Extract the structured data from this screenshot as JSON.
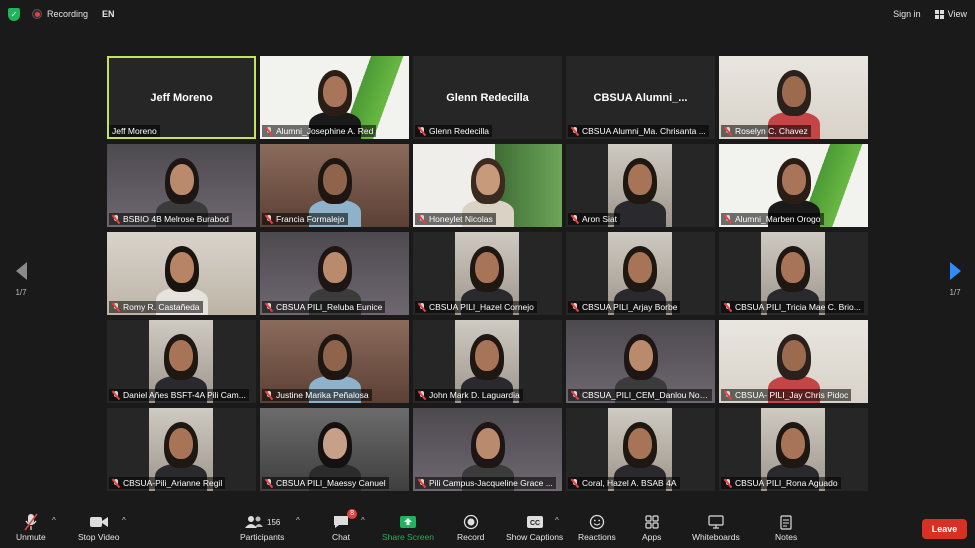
{
  "topbar": {
    "recording_label": "Recording",
    "language": "EN",
    "sign_in": "Sign in",
    "view": "View"
  },
  "pagination": {
    "left": "1/7",
    "right": "1/7"
  },
  "participants": [
    {
      "name": "Jeff Moreno",
      "center_name": "Jeff Moreno",
      "muted": false,
      "active": true,
      "video": false
    },
    {
      "name": "Alumni_Josephine A. Red",
      "muted": true,
      "video": true,
      "scene": "banner"
    },
    {
      "name": "Glenn Redecilla",
      "center_name": "Glenn Redecilla",
      "muted": true,
      "video": false
    },
    {
      "name": "CBSUA Alumni_Ma. Chrisanta ...",
      "center_name": "CBSUA  Alumni_...",
      "muted": true,
      "video": false
    },
    {
      "name": "Roselyn C. Chavez",
      "muted": true,
      "video": true,
      "scene": "light"
    },
    {
      "name": "BSBIO 4B Melrose Burabod",
      "muted": true,
      "video": true,
      "scene": "room"
    },
    {
      "name": "Francia Formalejo",
      "muted": true,
      "video": true,
      "scene": "warm"
    },
    {
      "name": "Honeylet Nicolas",
      "muted": true,
      "video": true,
      "scene": "plant"
    },
    {
      "name": "Aron Siat",
      "muted": true,
      "video": true,
      "scene": "portrait"
    },
    {
      "name": "Alumni_Marben Orogo",
      "muted": true,
      "video": true,
      "scene": "banner"
    },
    {
      "name": "Romy R. Castañeda",
      "muted": true,
      "video": true,
      "scene": "books"
    },
    {
      "name": "CBSUA PILI_Reluba Eunice",
      "muted": true,
      "video": true,
      "scene": "room"
    },
    {
      "name": "CBSUA PILI_Hazel Cornejo",
      "muted": true,
      "video": true,
      "scene": "portrait"
    },
    {
      "name": "CBSUA PILI_Arjay Borbe",
      "muted": true,
      "video": true,
      "scene": "portrait"
    },
    {
      "name": "CBSUA PILI_Tricia Mae C. Brio...",
      "muted": true,
      "video": true,
      "scene": "portrait"
    },
    {
      "name": "Daniel Añes BSFT-4A Pili Cam...",
      "muted": true,
      "video": true,
      "scene": "portrait"
    },
    {
      "name": "Justine Marika Peñalosa",
      "muted": true,
      "video": true,
      "scene": "warm"
    },
    {
      "name": "John Mark D. Laguardia",
      "muted": true,
      "video": true,
      "scene": "portrait"
    },
    {
      "name": "CBSUA_PILI_CEM_Danlou Nola...",
      "muted": true,
      "video": true,
      "scene": "room"
    },
    {
      "name": "CBSUA- PILI_Jay Chris Pidoc",
      "muted": true,
      "video": true,
      "scene": "light"
    },
    {
      "name": "CBSUA-Pili_Arianne Regil",
      "muted": true,
      "video": true,
      "scene": "portrait"
    },
    {
      "name": "CBSUA PILI_Maessy Canuel",
      "muted": true,
      "video": true,
      "scene": "close"
    },
    {
      "name": "Pili Campus-Jacqueline Grace ...",
      "muted": true,
      "video": true,
      "scene": "room"
    },
    {
      "name": "Coral, Hazel A. BSAB 4A",
      "muted": true,
      "video": true,
      "scene": "portrait"
    },
    {
      "name": "CBSUA PILI_Rona Aguado",
      "muted": true,
      "video": true,
      "scene": "portrait"
    }
  ],
  "toolbar": {
    "unmute": "Unmute",
    "stop_video": "Stop Video",
    "participants": "Participants",
    "participants_count": "156",
    "chat": "Chat",
    "chat_badge": "8",
    "share_screen": "Share Screen",
    "record": "Record",
    "show_captions": "Show Captions",
    "reactions": "Reactions",
    "apps": "Apps",
    "whiteboards": "Whiteboards",
    "notes": "Notes",
    "leave": "Leave"
  },
  "colors": {
    "active_speaker_border": "#c3e35a",
    "share_screen_green": "#1fb35a",
    "leave_red": "#d93025",
    "next_arrow_blue": "#2d8cff"
  }
}
